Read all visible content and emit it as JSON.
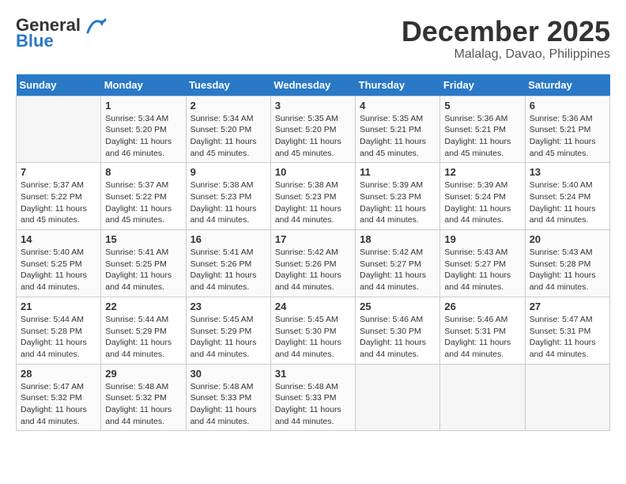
{
  "header": {
    "logo_line1": "General",
    "logo_line2": "Blue",
    "month": "December 2025",
    "location": "Malalag, Davao, Philippines"
  },
  "weekdays": [
    "Sunday",
    "Monday",
    "Tuesday",
    "Wednesday",
    "Thursday",
    "Friday",
    "Saturday"
  ],
  "weeks": [
    [
      {
        "day": "",
        "info": ""
      },
      {
        "day": "1",
        "info": "Sunrise: 5:34 AM\nSunset: 5:20 PM\nDaylight: 11 hours\nand 46 minutes."
      },
      {
        "day": "2",
        "info": "Sunrise: 5:34 AM\nSunset: 5:20 PM\nDaylight: 11 hours\nand 45 minutes."
      },
      {
        "day": "3",
        "info": "Sunrise: 5:35 AM\nSunset: 5:20 PM\nDaylight: 11 hours\nand 45 minutes."
      },
      {
        "day": "4",
        "info": "Sunrise: 5:35 AM\nSunset: 5:21 PM\nDaylight: 11 hours\nand 45 minutes."
      },
      {
        "day": "5",
        "info": "Sunrise: 5:36 AM\nSunset: 5:21 PM\nDaylight: 11 hours\nand 45 minutes."
      },
      {
        "day": "6",
        "info": "Sunrise: 5:36 AM\nSunset: 5:21 PM\nDaylight: 11 hours\nand 45 minutes."
      }
    ],
    [
      {
        "day": "7",
        "info": "Sunrise: 5:37 AM\nSunset: 5:22 PM\nDaylight: 11 hours\nand 45 minutes."
      },
      {
        "day": "8",
        "info": "Sunrise: 5:37 AM\nSunset: 5:22 PM\nDaylight: 11 hours\nand 45 minutes."
      },
      {
        "day": "9",
        "info": "Sunrise: 5:38 AM\nSunset: 5:23 PM\nDaylight: 11 hours\nand 44 minutes."
      },
      {
        "day": "10",
        "info": "Sunrise: 5:38 AM\nSunset: 5:23 PM\nDaylight: 11 hours\nand 44 minutes."
      },
      {
        "day": "11",
        "info": "Sunrise: 5:39 AM\nSunset: 5:23 PM\nDaylight: 11 hours\nand 44 minutes."
      },
      {
        "day": "12",
        "info": "Sunrise: 5:39 AM\nSunset: 5:24 PM\nDaylight: 11 hours\nand 44 minutes."
      },
      {
        "day": "13",
        "info": "Sunrise: 5:40 AM\nSunset: 5:24 PM\nDaylight: 11 hours\nand 44 minutes."
      }
    ],
    [
      {
        "day": "14",
        "info": "Sunrise: 5:40 AM\nSunset: 5:25 PM\nDaylight: 11 hours\nand 44 minutes."
      },
      {
        "day": "15",
        "info": "Sunrise: 5:41 AM\nSunset: 5:25 PM\nDaylight: 11 hours\nand 44 minutes."
      },
      {
        "day": "16",
        "info": "Sunrise: 5:41 AM\nSunset: 5:26 PM\nDaylight: 11 hours\nand 44 minutes."
      },
      {
        "day": "17",
        "info": "Sunrise: 5:42 AM\nSunset: 5:26 PM\nDaylight: 11 hours\nand 44 minutes."
      },
      {
        "day": "18",
        "info": "Sunrise: 5:42 AM\nSunset: 5:27 PM\nDaylight: 11 hours\nand 44 minutes."
      },
      {
        "day": "19",
        "info": "Sunrise: 5:43 AM\nSunset: 5:27 PM\nDaylight: 11 hours\nand 44 minutes."
      },
      {
        "day": "20",
        "info": "Sunrise: 5:43 AM\nSunset: 5:28 PM\nDaylight: 11 hours\nand 44 minutes."
      }
    ],
    [
      {
        "day": "21",
        "info": "Sunrise: 5:44 AM\nSunset: 5:28 PM\nDaylight: 11 hours\nand 44 minutes."
      },
      {
        "day": "22",
        "info": "Sunrise: 5:44 AM\nSunset: 5:29 PM\nDaylight: 11 hours\nand 44 minutes."
      },
      {
        "day": "23",
        "info": "Sunrise: 5:45 AM\nSunset: 5:29 PM\nDaylight: 11 hours\nand 44 minutes."
      },
      {
        "day": "24",
        "info": "Sunrise: 5:45 AM\nSunset: 5:30 PM\nDaylight: 11 hours\nand 44 minutes."
      },
      {
        "day": "25",
        "info": "Sunrise: 5:46 AM\nSunset: 5:30 PM\nDaylight: 11 hours\nand 44 minutes."
      },
      {
        "day": "26",
        "info": "Sunrise: 5:46 AM\nSunset: 5:31 PM\nDaylight: 11 hours\nand 44 minutes."
      },
      {
        "day": "27",
        "info": "Sunrise: 5:47 AM\nSunset: 5:31 PM\nDaylight: 11 hours\nand 44 minutes."
      }
    ],
    [
      {
        "day": "28",
        "info": "Sunrise: 5:47 AM\nSunset: 5:32 PM\nDaylight: 11 hours\nand 44 minutes."
      },
      {
        "day": "29",
        "info": "Sunrise: 5:48 AM\nSunset: 5:32 PM\nDaylight: 11 hours\nand 44 minutes."
      },
      {
        "day": "30",
        "info": "Sunrise: 5:48 AM\nSunset: 5:33 PM\nDaylight: 11 hours\nand 44 minutes."
      },
      {
        "day": "31",
        "info": "Sunrise: 5:48 AM\nSunset: 5:33 PM\nDaylight: 11 hours\nand 44 minutes."
      },
      {
        "day": "",
        "info": ""
      },
      {
        "day": "",
        "info": ""
      },
      {
        "day": "",
        "info": ""
      }
    ]
  ]
}
